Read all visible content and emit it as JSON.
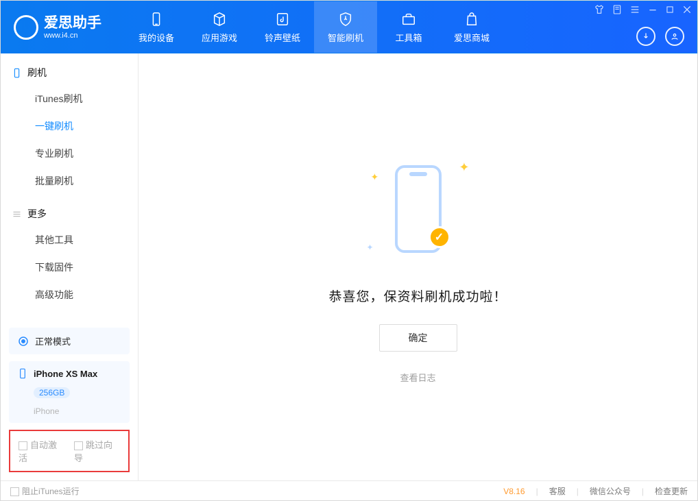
{
  "brand": {
    "name": "爱思助手",
    "site": "www.i4.cn"
  },
  "nav": {
    "items": [
      {
        "label": "我的设备"
      },
      {
        "label": "应用游戏"
      },
      {
        "label": "铃声壁纸"
      },
      {
        "label": "智能刷机"
      },
      {
        "label": "工具箱"
      },
      {
        "label": "爱思商城"
      }
    ],
    "active_index": 3
  },
  "sidebar": {
    "groups": [
      {
        "title": "刷机",
        "items": [
          {
            "label": "iTunes刷机"
          },
          {
            "label": "一键刷机"
          },
          {
            "label": "专业刷机"
          },
          {
            "label": "批量刷机"
          }
        ],
        "active_index": 1
      },
      {
        "title": "更多",
        "items": [
          {
            "label": "其他工具"
          },
          {
            "label": "下载固件"
          },
          {
            "label": "高级功能"
          }
        ]
      }
    ],
    "mode_card": {
      "label": "正常模式"
    },
    "device_card": {
      "name": "iPhone XS Max",
      "capacity": "256GB",
      "type": "iPhone"
    },
    "options": {
      "auto_activate": "自动激活",
      "skip_guide": "跳过向导"
    }
  },
  "main": {
    "success_text": "恭喜您，保资料刷机成功啦！",
    "ok_button": "确定",
    "view_log": "查看日志"
  },
  "statusbar": {
    "block_itunes": "阻止iTunes运行",
    "version": "V8.16",
    "service": "客服",
    "wechat": "微信公众号",
    "check_update": "检查更新"
  }
}
